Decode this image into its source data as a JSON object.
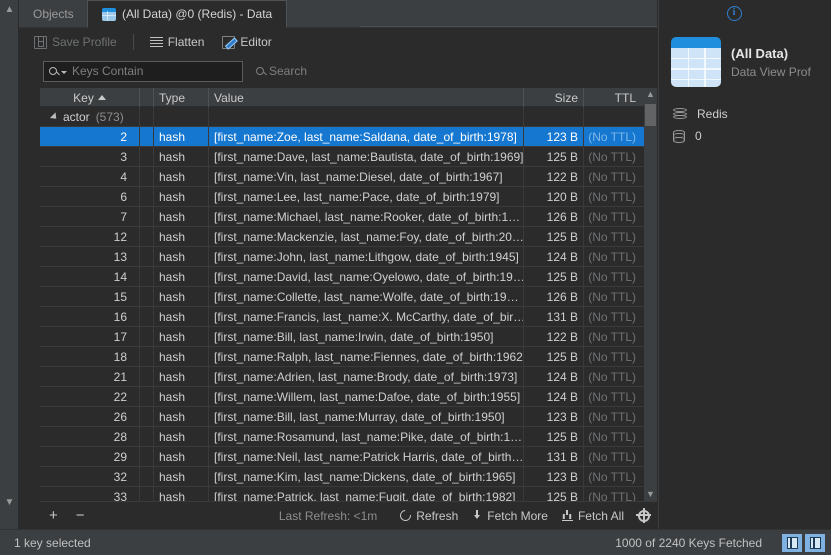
{
  "tabs": [
    {
      "label": "Objects",
      "icon": "none",
      "active": false
    },
    {
      "label": "(All Data) @0 (Redis) - Data",
      "icon": "table-icon",
      "active": true
    }
  ],
  "toolbar": {
    "save_profile": "Save Profile",
    "flatten": "Flatten",
    "editor": "Editor"
  },
  "search": {
    "placeholder": "Keys Contain",
    "value": "",
    "search_button": "Search"
  },
  "table": {
    "columns": [
      "Key",
      "Type",
      "Value",
      "Size",
      "TTL"
    ],
    "sort_column": "Key",
    "sort_direction": "asc",
    "group": {
      "label": "actor",
      "count": "(573)"
    },
    "rows": [
      {
        "key": "2",
        "type": "hash",
        "value": "[first_name:Zoe, last_name:Saldana, date_of_birth:1978]",
        "size": "123 B",
        "ttl": "(No TTL)",
        "selected": true
      },
      {
        "key": "3",
        "type": "hash",
        "value": "[first_name:Dave, last_name:Bautista, date_of_birth:1969]",
        "size": "125 B",
        "ttl": "(No TTL)",
        "selected": false
      },
      {
        "key": "4",
        "type": "hash",
        "value": "[first_name:Vin, last_name:Diesel, date_of_birth:1967]",
        "size": "122 B",
        "ttl": "(No TTL)",
        "selected": false
      },
      {
        "key": "6",
        "type": "hash",
        "value": "[first_name:Lee, last_name:Pace, date_of_birth:1979]",
        "size": "120 B",
        "ttl": "(No TTL)",
        "selected": false
      },
      {
        "key": "7",
        "type": "hash",
        "value": "[first_name:Michael, last_name:Rooker, date_of_birth:1…",
        "size": "126 B",
        "ttl": "(No TTL)",
        "selected": false
      },
      {
        "key": "12",
        "type": "hash",
        "value": "[first_name:Mackenzie, last_name:Foy, date_of_birth:20…",
        "size": "125 B",
        "ttl": "(No TTL)",
        "selected": false
      },
      {
        "key": "13",
        "type": "hash",
        "value": "[first_name:John, last_name:Lithgow, date_of_birth:1945]",
        "size": "124 B",
        "ttl": "(No TTL)",
        "selected": false
      },
      {
        "key": "14",
        "type": "hash",
        "value": "[first_name:David, last_name:Oyelowo, date_of_birth:19…",
        "size": "125 B",
        "ttl": "(No TTL)",
        "selected": false
      },
      {
        "key": "15",
        "type": "hash",
        "value": "[first_name:Collette, last_name:Wolfe, date_of_birth:19…",
        "size": "126 B",
        "ttl": "(No TTL)",
        "selected": false
      },
      {
        "key": "16",
        "type": "hash",
        "value": "[first_name:Francis, last_name:X. McCarthy, date_of_bir…",
        "size": "131 B",
        "ttl": "(No TTL)",
        "selected": false
      },
      {
        "key": "17",
        "type": "hash",
        "value": "[first_name:Bill, last_name:Irwin, date_of_birth:1950]",
        "size": "122 B",
        "ttl": "(No TTL)",
        "selected": false
      },
      {
        "key": "18",
        "type": "hash",
        "value": "[first_name:Ralph, last_name:Fiennes, date_of_birth:1962]",
        "size": "125 B",
        "ttl": "(No TTL)",
        "selected": false
      },
      {
        "key": "21",
        "type": "hash",
        "value": "[first_name:Adrien, last_name:Brody, date_of_birth:1973]",
        "size": "124 B",
        "ttl": "(No TTL)",
        "selected": false
      },
      {
        "key": "22",
        "type": "hash",
        "value": "[first_name:Willem, last_name:Dafoe, date_of_birth:1955]",
        "size": "124 B",
        "ttl": "(No TTL)",
        "selected": false
      },
      {
        "key": "26",
        "type": "hash",
        "value": "[first_name:Bill, last_name:Murray, date_of_birth:1950]",
        "size": "123 B",
        "ttl": "(No TTL)",
        "selected": false
      },
      {
        "key": "28",
        "type": "hash",
        "value": "[first_name:Rosamund, last_name:Pike, date_of_birth:1…",
        "size": "125 B",
        "ttl": "(No TTL)",
        "selected": false
      },
      {
        "key": "29",
        "type": "hash",
        "value": "[first_name:Neil, last_name:Patrick Harris, date_of_birth…",
        "size": "131 B",
        "ttl": "(No TTL)",
        "selected": false
      },
      {
        "key": "32",
        "type": "hash",
        "value": "[first_name:Kim, last_name:Dickens, date_of_birth:1965]",
        "size": "123 B",
        "ttl": "(No TTL)",
        "selected": false
      },
      {
        "key": "33",
        "type": "hash",
        "value": "[first_name:Patrick, last_name:Fugit, date_of_birth:1982]",
        "size": "125 B",
        "ttl": "(No TTL)",
        "selected": false
      }
    ]
  },
  "bottombar": {
    "add": "+",
    "remove": "−",
    "last_refresh": "Last Refresh: <1m",
    "refresh": "Refresh",
    "fetch_more": "Fetch More",
    "fetch_all": "Fetch All"
  },
  "sidebar": {
    "title": "(All Data)",
    "subtitle": "Data View Prof",
    "properties": [
      {
        "icon": "stack-icon",
        "label": "Redis"
      },
      {
        "icon": "database-icon",
        "label": "0"
      }
    ]
  },
  "statusbar": {
    "selection": "1 key selected",
    "fetched": "1000 of 2240 Keys Fetched"
  },
  "colors": {
    "selection_blue": "#1577d0",
    "accent_blue": "#2f7fd0",
    "background": "#2b2b2b",
    "chrome": "#3c3f41"
  }
}
